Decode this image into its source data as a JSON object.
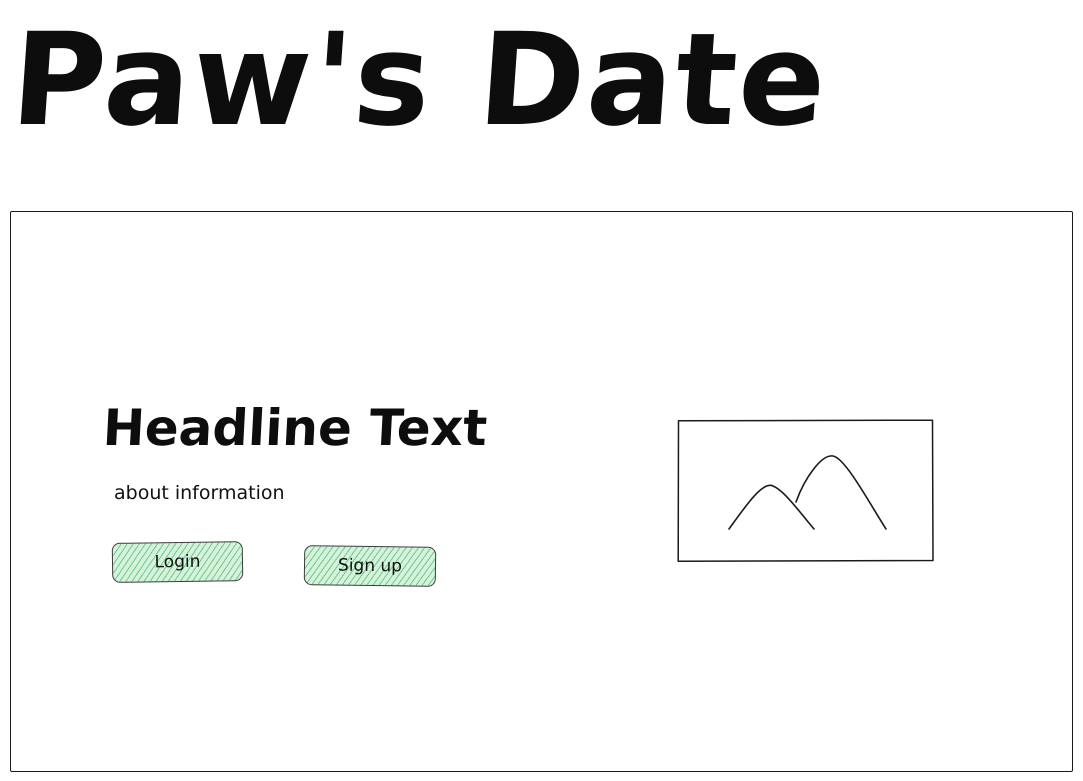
{
  "header": {
    "title": "Paw's Date"
  },
  "hero": {
    "headline": "Headline Text",
    "about": "about information",
    "login_label": "Login",
    "signup_label": "Sign up",
    "image_icon": "image-placeholder-icon"
  },
  "colors": {
    "button_fill": "#d3f3dc",
    "button_hatch": "#2f9e44",
    "stroke": "#1a1a1a"
  }
}
